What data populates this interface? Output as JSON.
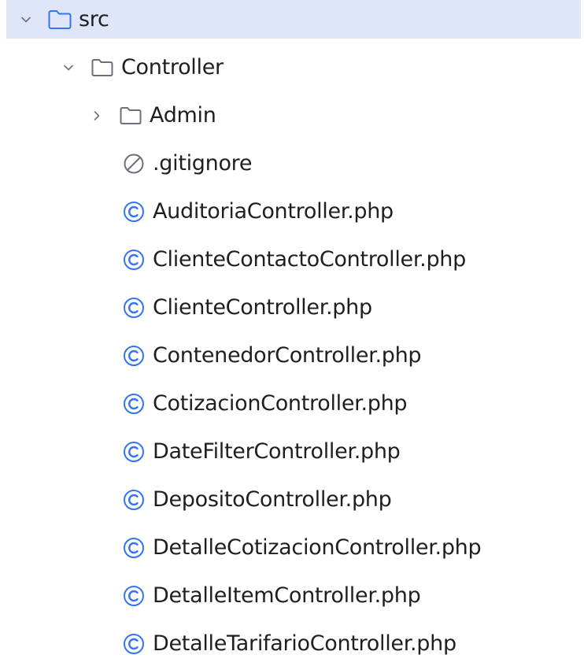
{
  "tree": {
    "root": {
      "label": "src",
      "icon": "folder-icon",
      "expanded": true,
      "selected": true
    },
    "controller": {
      "label": "Controller",
      "icon": "folder-icon",
      "expanded": true
    },
    "admin": {
      "label": "Admin",
      "icon": "folder-icon",
      "expanded": false
    },
    "files": [
      {
        "label": ".gitignore",
        "icon": "ignored-file-icon"
      },
      {
        "label": "AuditoriaController.php",
        "icon": "php-class-icon"
      },
      {
        "label": "ClienteContactoController.php",
        "icon": "php-class-icon"
      },
      {
        "label": "ClienteController.php",
        "icon": "php-class-icon"
      },
      {
        "label": "ContenedorController.php",
        "icon": "php-class-icon"
      },
      {
        "label": "CotizacionController.php",
        "icon": "php-class-icon"
      },
      {
        "label": "DateFilterController.php",
        "icon": "php-class-icon"
      },
      {
        "label": "DepositoController.php",
        "icon": "php-class-icon"
      },
      {
        "label": "DetalleCotizacionController.php",
        "icon": "php-class-icon"
      },
      {
        "label": "DetalleItemController.php",
        "icon": "php-class-icon"
      },
      {
        "label": "DetalleTarifarioController.php",
        "icon": "php-class-icon"
      }
    ]
  },
  "colors": {
    "selection_background": "#dfe6f9",
    "root_folder_icon": "#3574f0",
    "folder_icon": "#6c707e",
    "class_icon": "#3574f0",
    "ignored_icon": "#6c707e",
    "text": "#1e1f22"
  }
}
